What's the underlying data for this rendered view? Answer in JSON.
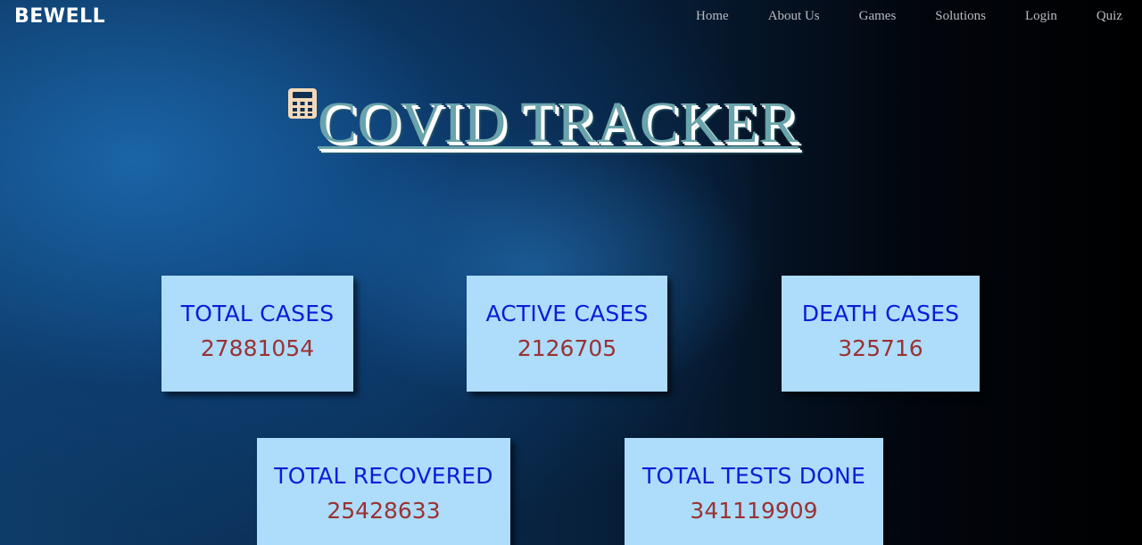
{
  "navbar": {
    "brand": "BEWELL",
    "links": [
      {
        "label": "Home"
      },
      {
        "label": "About Us"
      },
      {
        "label": "Games"
      },
      {
        "label": "Solutions"
      },
      {
        "label": "Login"
      },
      {
        "label": "Quiz"
      }
    ]
  },
  "header": {
    "title": "COVID TRACKER",
    "icon": "calculator-icon"
  },
  "colors": {
    "card_background": "#aedcfb",
    "card_label": "#0a1dd6",
    "card_value": "#9a3232",
    "title": "#6aa3ab",
    "icon": "#f3d9b8"
  },
  "stats": {
    "total_cases": {
      "label": "TOTAL CASES",
      "value": "27881054"
    },
    "active_cases": {
      "label": "ACTIVE CASES",
      "value": "2126705"
    },
    "death_cases": {
      "label": "DEATH CASES",
      "value": "325716"
    },
    "total_recovered": {
      "label": "TOTAL RECOVERED",
      "value": "25428633"
    },
    "total_tests": {
      "label": "TOTAL TESTS DONE",
      "value": "341119909"
    }
  }
}
